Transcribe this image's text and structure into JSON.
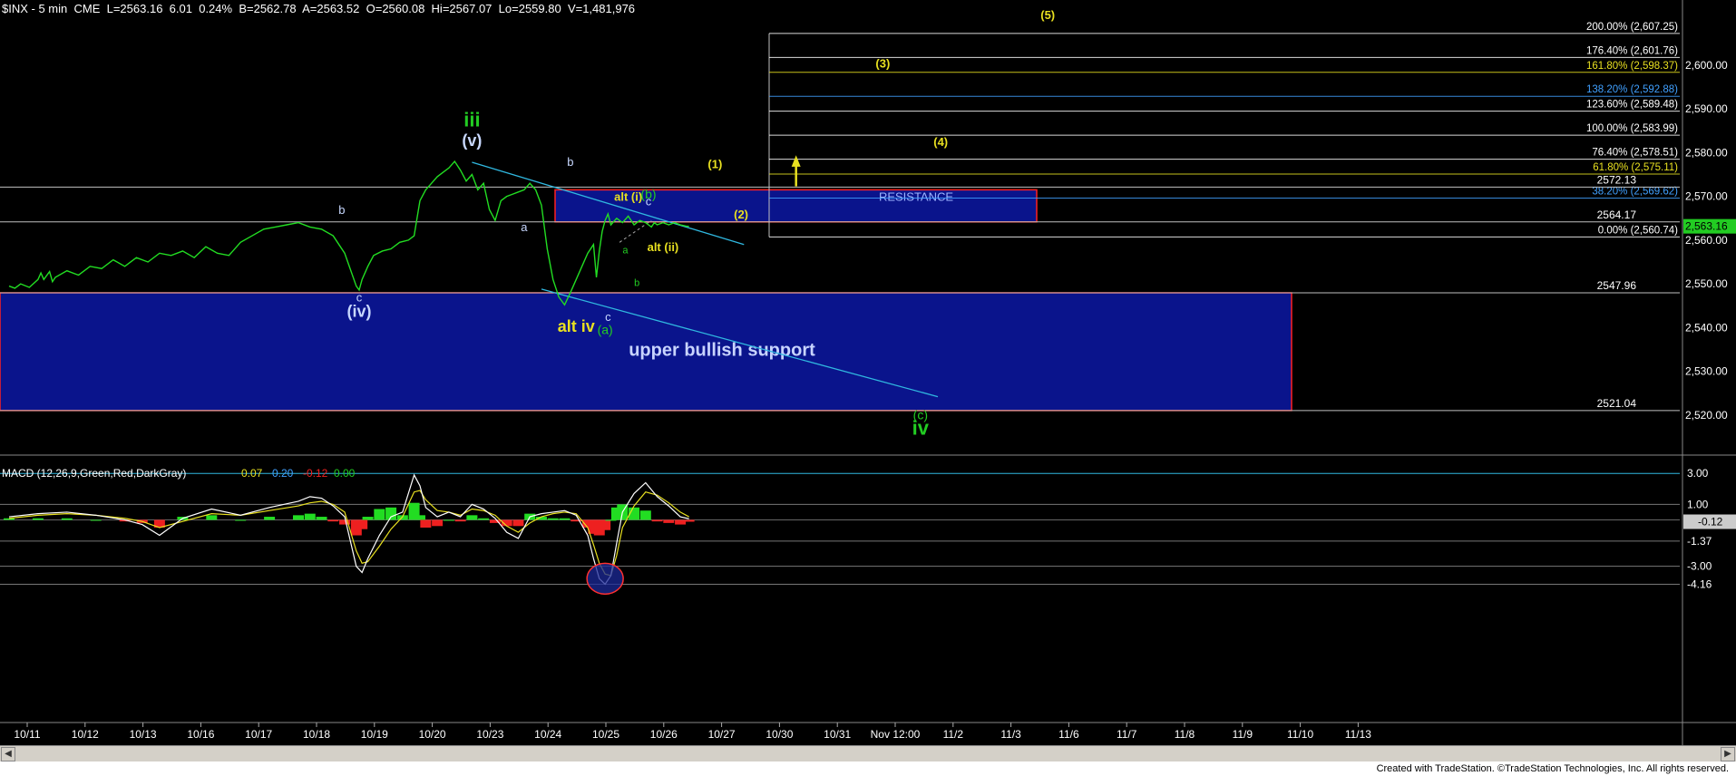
{
  "header": {
    "symbol": "$INX - 5 min",
    "exchange": "CME",
    "last": "L=2563.16",
    "change": "6.01",
    "change_pct": "0.24%",
    "bid": "B=2562.78",
    "ask": "A=2563.52",
    "open": "O=2560.08",
    "high": "Hi=2567.07",
    "low": "Lo=2559.80",
    "volume": "V=1,481,976"
  },
  "colors": {
    "background": "#000000",
    "price_line": "#22dd22",
    "zone_fill": "#0a148c",
    "zone_border": "#ff2020",
    "wave_green": "#22cc22",
    "wave_white": "#c8d8ff",
    "wave_yellow": "#e8e020",
    "fib_line": "#c0c0c0",
    "trend_line": "#30b8e0",
    "macd_line": "#ffffff",
    "signal_line": "#e8e020",
    "hist_pos": "#22dd22",
    "hist_neg": "#ee2020"
  },
  "chart_data": [
    {
      "type": "line",
      "title": "$INX - 5 min",
      "y_axis": {
        "ticks": [
          "2,600.00",
          "2,590.00",
          "2,580.00",
          "2,570.00",
          "2,560.00",
          "2,550.00",
          "2,540.00",
          "2,530.00",
          "2,520.00"
        ],
        "range": [
          2515,
          2612
        ]
      },
      "x_axis": {
        "ticks": [
          "10/11",
          "10/12",
          "10/13",
          "10/16",
          "10/17",
          "10/18",
          "10/19",
          "10/20",
          "10/23",
          "10/24",
          "10/25",
          "10/26",
          "10/27",
          "10/30",
          "10/31",
          "Nov 12:00",
          "11/2",
          "11/3",
          "11/6",
          "11/7",
          "11/8",
          "11/9",
          "11/10",
          "11/13"
        ]
      },
      "series": [
        {
          "name": "$INX",
          "x": [
            0.0,
            0.1,
            0.2,
            0.35,
            0.5,
            0.55,
            0.6,
            0.7,
            0.75,
            0.8,
            1.0,
            1.2,
            1.4,
            1.6,
            1.8,
            2.0,
            2.2,
            2.4,
            2.6,
            2.8,
            3.0,
            3.2,
            3.4,
            3.6,
            3.8,
            4.0,
            4.2,
            4.4,
            4.6,
            4.8,
            5.0,
            5.2,
            5.4,
            5.6,
            5.8,
            6.0,
            6.05,
            6.1,
            6.2,
            6.3,
            6.45,
            6.6,
            6.75,
            6.9,
            7.0,
            7.05,
            7.1,
            7.2,
            7.3,
            7.4,
            7.5,
            7.6,
            7.7,
            7.8,
            7.9,
            8.0,
            8.1,
            8.2,
            8.3,
            8.4,
            8.5,
            8.6,
            8.7,
            8.8,
            8.9,
            9.0,
            9.1,
            9.2,
            9.3,
            9.4,
            9.5,
            9.6,
            9.7,
            9.8,
            9.9,
            10.0,
            10.1,
            10.15,
            10.2,
            10.25,
            10.3,
            10.35,
            10.4,
            10.5,
            10.6,
            10.7,
            10.8,
            10.9,
            11.0,
            11.1,
            11.15,
            11.2,
            11.3,
            11.4,
            11.5,
            11.6,
            11.7,
            11.75
          ],
          "values": [
            2549.5,
            2549.0,
            2550.0,
            2549.2,
            2551.0,
            2552.5,
            2551.0,
            2552.8,
            2550.5,
            2551.5,
            2553.0,
            2552.0,
            2554.0,
            2553.5,
            2555.5,
            2554.0,
            2556.0,
            2555.0,
            2557.0,
            2556.5,
            2557.5,
            2556.0,
            2558.5,
            2557.0,
            2556.5,
            2559.5,
            2561.0,
            2562.5,
            2563.0,
            2563.5,
            2564.0,
            2563.0,
            2562.5,
            2561.0,
            2557.0,
            2549.5,
            2548.6,
            2551.0,
            2554.0,
            2556.5,
            2557.5,
            2558.0,
            2559.5,
            2560.0,
            2561.0,
            2565.0,
            2569.0,
            2571.5,
            2573.0,
            2574.5,
            2575.5,
            2576.5,
            2578.0,
            2576.0,
            2573.5,
            2575.0,
            2571.5,
            2573.0,
            2567.0,
            2564.5,
            2569.0,
            2570.0,
            2570.5,
            2571.0,
            2571.5,
            2573.0,
            2571.5,
            2568.0,
            2558.0,
            2551.0,
            2547.0,
            2545.2,
            2548.0,
            2551.0,
            2554.0,
            2557.0,
            2559.0,
            2551.5,
            2557.5,
            2562.0,
            2564.5,
            2566.0,
            2563.5,
            2565.0,
            2564.0,
            2565.5,
            2563.5,
            2564.5,
            2564.0,
            2563.0,
            2564.0,
            2563.5,
            2564.0,
            2563.5,
            2564.0,
            2563.5,
            2563.2,
            2563.16
          ]
        }
      ],
      "last_price_tag": "2,563.16",
      "levels": [
        {
          "label": "200.00% (2,607.25)",
          "value": 2607.25,
          "color": "#ffffff"
        },
        {
          "label": "176.40% (2,601.76)",
          "value": 2601.76,
          "color": "#ffffff"
        },
        {
          "label": "161.80% (2,598.37)",
          "value": 2598.37,
          "color": "#e8e020"
        },
        {
          "label": "138.20% (2,592.88)",
          "value": 2592.88,
          "color": "#40a0ff"
        },
        {
          "label": "123.60% (2,589.48)",
          "value": 2589.48,
          "color": "#ffffff"
        },
        {
          "label": "100.00% (2,583.99)",
          "value": 2583.99,
          "color": "#ffffff"
        },
        {
          "label": "76.40% (2,578.51)",
          "value": 2578.51,
          "color": "#ffffff"
        },
        {
          "label": "61.80% (2,575.11)",
          "value": 2575.11,
          "color": "#e8e020"
        },
        {
          "label": "38.20% (2,569.62)",
          "value": 2569.62,
          "color": "#40a0ff"
        },
        {
          "label": "0.00% (2,560.74)",
          "value": 2560.74,
          "color": "#ffffff"
        }
      ],
      "horizontal_lines": [
        {
          "label": "2572.13",
          "value": 2572.13
        },
        {
          "label": "2564.17",
          "value": 2564.17
        },
        {
          "label": "2547.96",
          "value": 2547.96
        },
        {
          "label": "2521.04",
          "value": 2521.04
        }
      ],
      "zones": [
        {
          "label": "RESISTANCE",
          "from": 2564.17,
          "to": 2571.5
        },
        {
          "label": "upper bullish support",
          "from": 2521.04,
          "to": 2547.96
        }
      ],
      "wave_labels": [
        {
          "text": "iii",
          "x": 8.0,
          "y": 2586.0,
          "style": "green-big"
        },
        {
          "text": "(v)",
          "x": 8.0,
          "y": 2581.5,
          "style": "white-big"
        },
        {
          "text": "b",
          "x": 5.75,
          "y": 2566.0,
          "style": "white-small"
        },
        {
          "text": "c",
          "x": 6.05,
          "y": 2546.0,
          "style": "white-small"
        },
        {
          "text": "(iv)",
          "x": 6.05,
          "y": 2542.5,
          "style": "white-big"
        },
        {
          "text": "a",
          "x": 8.9,
          "y": 2562.0,
          "style": "white-small"
        },
        {
          "text": "b",
          "x": 9.7,
          "y": 2577.0,
          "style": "white-small"
        },
        {
          "text": "c",
          "x": 10.35,
          "y": 2541.5,
          "style": "white-small"
        },
        {
          "text": "(a)",
          "x": 10.3,
          "y": 2538.5,
          "style": "green-small"
        },
        {
          "text": "alt iv",
          "x": 9.8,
          "y": 2539.0,
          "style": "yellow-big"
        },
        {
          "text": "a",
          "x": 10.65,
          "y": 2557.0,
          "style": "green-tiny"
        },
        {
          "text": "b",
          "x": 10.85,
          "y": 2549.5,
          "style": "green-tiny"
        },
        {
          "text": "c",
          "x": 11.05,
          "y": 2568.0,
          "style": "white-small"
        },
        {
          "text": "alt (i)",
          "x": 10.7,
          "y": 2569.0,
          "style": "yellow-small"
        },
        {
          "text": "(b)",
          "x": 11.05,
          "y": 2569.5,
          "style": "green-small"
        },
        {
          "text": "alt (ii)",
          "x": 11.3,
          "y": 2557.5,
          "style": "yellow-small"
        },
        {
          "text": "(1)",
          "x": 12.2,
          "y": 2576.5,
          "style": "yellow-small"
        },
        {
          "text": "(2)",
          "x": 12.65,
          "y": 2565.0,
          "style": "yellow-small"
        },
        {
          "text": "(3)",
          "x": 15.1,
          "y": 2599.5,
          "style": "yellow-small"
        },
        {
          "text": "(4)",
          "x": 16.1,
          "y": 2581.5,
          "style": "yellow-small"
        },
        {
          "text": "(5)",
          "x": 17.95,
          "y": 2610.5,
          "style": "yellow-small"
        },
        {
          "text": "(c)",
          "x": 15.75,
          "y": 2519.0,
          "style": "green-small"
        },
        {
          "text": "iv",
          "x": 15.75,
          "y": 2515.5,
          "style": "green-big"
        }
      ],
      "annotations": [
        {
          "text": "RESISTANCE"
        },
        {
          "text": "upper bullish support"
        }
      ]
    },
    {
      "type": "line",
      "title": "MACD (12,26,9,Green,Red,DarkGray)",
      "legend_values": [
        "0.07",
        "0.20",
        "-0.12",
        "0.00"
      ],
      "y_axis": {
        "ticks": [
          "3.00",
          "1.00",
          "-1.37",
          "-3.00",
          "-4.16"
        ],
        "last_tag": "-0.12",
        "range": [
          -4.6,
          3.6
        ]
      },
      "series": [
        {
          "name": "MACD",
          "x": [
            0.0,
            0.5,
            1.0,
            1.5,
            2.0,
            2.3,
            2.6,
            3.0,
            3.5,
            4.0,
            4.5,
            5.0,
            5.2,
            5.4,
            5.6,
            5.8,
            6.0,
            6.1,
            6.2,
            6.4,
            6.6,
            6.8,
            7.0,
            7.1,
            7.2,
            7.4,
            7.6,
            7.8,
            8.0,
            8.2,
            8.4,
            8.6,
            8.8,
            9.0,
            9.2,
            9.4,
            9.6,
            9.8,
            10.0,
            10.1,
            10.2,
            10.3,
            10.4,
            10.5,
            10.6,
            10.8,
            11.0,
            11.2,
            11.4,
            11.6,
            11.75
          ],
          "values": [
            0.2,
            0.4,
            0.5,
            0.3,
            0.0,
            -0.3,
            -1.0,
            0.1,
            0.7,
            0.3,
            0.8,
            1.2,
            1.5,
            1.4,
            0.9,
            0.2,
            -3.0,
            -3.4,
            -2.5,
            -1.0,
            0.2,
            0.5,
            2.9,
            2.2,
            0.8,
            0.2,
            0.5,
            0.2,
            1.0,
            0.7,
            0.1,
            -0.8,
            -1.2,
            0.2,
            0.4,
            0.5,
            0.6,
            0.3,
            -1.0,
            -2.5,
            -3.8,
            -4.16,
            -3.6,
            -1.5,
            0.5,
            1.7,
            2.4,
            1.5,
            0.9,
            0.2,
            0.07
          ]
        },
        {
          "name": "Signal",
          "x": [
            0.0,
            0.5,
            1.0,
            1.5,
            2.0,
            2.3,
            2.6,
            3.0,
            3.5,
            4.0,
            4.5,
            5.0,
            5.2,
            5.4,
            5.6,
            5.8,
            6.0,
            6.1,
            6.2,
            6.4,
            6.6,
            6.8,
            7.0,
            7.1,
            7.2,
            7.4,
            7.6,
            7.8,
            8.0,
            8.2,
            8.4,
            8.6,
            8.8,
            9.0,
            9.2,
            9.4,
            9.6,
            9.8,
            10.0,
            10.1,
            10.2,
            10.3,
            10.4,
            10.5,
            10.6,
            10.8,
            11.0,
            11.2,
            11.4,
            11.6,
            11.75
          ],
          "values": [
            0.1,
            0.3,
            0.4,
            0.3,
            0.1,
            -0.1,
            -0.5,
            -0.1,
            0.4,
            0.3,
            0.6,
            0.9,
            1.1,
            1.2,
            1.0,
            0.5,
            -2.0,
            -2.8,
            -2.7,
            -1.7,
            -0.6,
            0.2,
            1.8,
            1.9,
            1.3,
            0.6,
            0.5,
            0.3,
            0.7,
            0.6,
            0.3,
            -0.4,
            -0.8,
            -0.2,
            0.2,
            0.4,
            0.5,
            0.4,
            -0.5,
            -1.6,
            -2.8,
            -3.5,
            -3.6,
            -2.3,
            -0.5,
            0.9,
            1.8,
            1.6,
            1.1,
            0.5,
            0.2
          ]
        },
        {
          "name": "Histogram",
          "x": [
            0.0,
            0.5,
            1.0,
            1.5,
            2.0,
            2.3,
            2.6,
            3.0,
            3.5,
            4.0,
            4.5,
            5.0,
            5.2,
            5.4,
            5.6,
            5.8,
            6.0,
            6.1,
            6.2,
            6.4,
            6.6,
            6.8,
            7.0,
            7.1,
            7.2,
            7.4,
            7.6,
            7.8,
            8.0,
            8.2,
            8.4,
            8.6,
            8.8,
            9.0,
            9.2,
            9.4,
            9.6,
            9.8,
            10.0,
            10.1,
            10.2,
            10.3,
            10.4,
            10.5,
            10.6,
            10.8,
            11.0,
            11.2,
            11.4,
            11.6,
            11.75
          ],
          "values": [
            0.1,
            0.1,
            0.1,
            0.0,
            -0.1,
            -0.2,
            -0.5,
            0.2,
            0.3,
            0.0,
            0.2,
            0.3,
            0.4,
            0.2,
            -0.1,
            -0.3,
            -1.0,
            -0.6,
            0.2,
            0.7,
            0.8,
            0.3,
            1.1,
            0.3,
            -0.5,
            -0.4,
            0.0,
            -0.1,
            0.3,
            0.1,
            -0.2,
            -0.4,
            -0.4,
            0.4,
            0.2,
            0.1,
            0.1,
            -0.1,
            -0.5,
            -0.9,
            -1.0,
            -0.66,
            0.0,
            0.8,
            1.0,
            0.8,
            0.6,
            -0.1,
            -0.2,
            -0.3,
            -0.12
          ]
        }
      ]
    }
  ],
  "footer": {
    "credit": "Created with TradeStation. ©TradeStation Technologies, Inc. All rights reserved."
  }
}
